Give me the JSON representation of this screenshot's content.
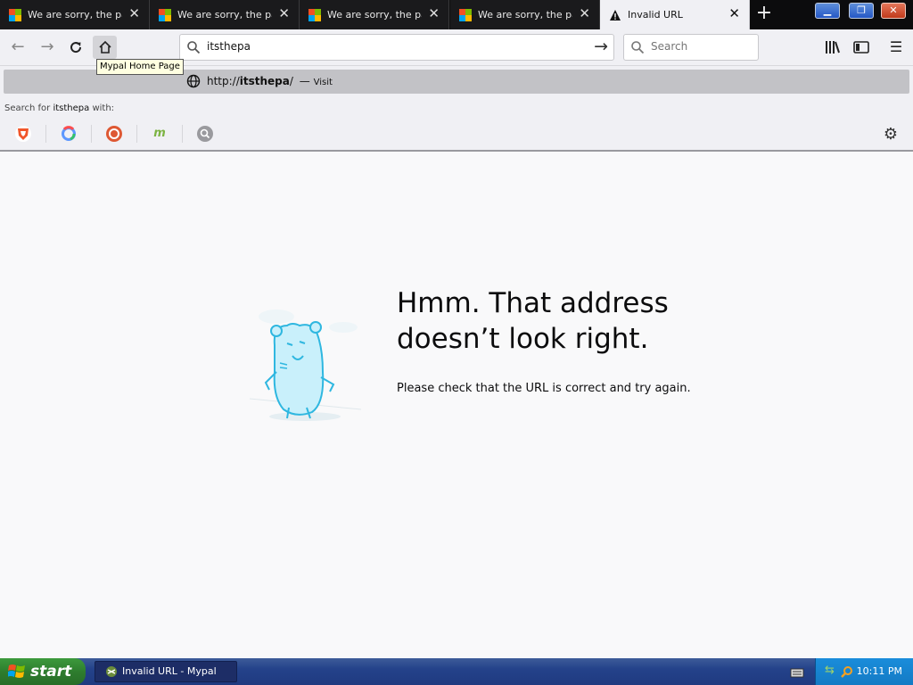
{
  "tabs": [
    {
      "title": "We are sorry, the page you requested cannot be found.",
      "icon": "microsoft-logo-icon",
      "active": false
    },
    {
      "title": "We are sorry, the page you requested cannot be found.",
      "icon": "microsoft-logo-icon",
      "active": false
    },
    {
      "title": "We are sorry, the page you requested cannot be found.",
      "icon": "microsoft-logo-icon",
      "active": false
    },
    {
      "title": "We are sorry, the page you requested cannot be found.",
      "icon": "microsoft-logo-icon",
      "active": false
    },
    {
      "title": "Invalid URL",
      "icon": "warning-icon",
      "active": true
    }
  ],
  "toolbar": {
    "url_value": "itsthepa",
    "search_placeholder": "Search",
    "home_tooltip": "Mypal Home Page"
  },
  "dropdown": {
    "suggestion_prefix": "http://",
    "suggestion_domain": "itsthepa",
    "suggestion_suffix": "/",
    "suggestion_separator": "—",
    "suggestion_action": "Visit",
    "search_for_prefix": "Search for ",
    "search_for_term": "itsthepa",
    "search_for_suffix": " with:",
    "engines": [
      "brave-icon",
      "qwant-icon",
      "duckduckgo-icon",
      "mojeek-icon",
      "search-engine-icon"
    ]
  },
  "error": {
    "title_line1": "Hmm. That address",
    "title_line2": "doesn’t look right.",
    "message": "Please check that the URL is correct and try again."
  },
  "taskbar": {
    "start_label": "start",
    "task_label": "Invalid URL - Mypal",
    "clock": "10:11 PM"
  },
  "colors": {
    "accent_blue": "#245edc",
    "content_bg": "#f9f9fa",
    "taskbar_blue": "#24428a",
    "start_green": "#2e7d2e"
  }
}
